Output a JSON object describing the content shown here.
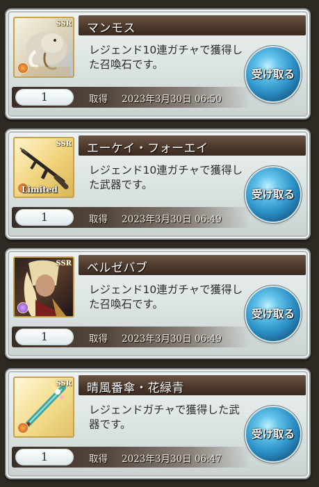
{
  "items": [
    {
      "name": "マンモス",
      "description": "レジェンド10連ガチャで獲得した召喚石です。",
      "rarity": "SSR",
      "element_color": "#c3521b",
      "element": "fire",
      "limited": "",
      "quantity": "1",
      "acquired_label": "取得",
      "date": "2023年3月30日 06:50",
      "button_label": "受け取る",
      "art": "mammoth"
    },
    {
      "name": "エーケイ・フォーエイ",
      "description": "レジェンド10連ガチャで獲得した武器です。",
      "rarity": "SSR",
      "element_color": "#c3521b",
      "element": "fire",
      "limited": "Limited",
      "quantity": "1",
      "acquired_label": "取得",
      "date": "2023年3月30日 06:49",
      "button_label": "受け取る",
      "art": "rifle"
    },
    {
      "name": "ベルゼバブ",
      "description": "レジェンド10連ガチャで獲得した召喚石です。",
      "rarity": "SSR",
      "element_color": "#7b3cc4",
      "element": "dark",
      "limited": "",
      "quantity": "1",
      "acquired_label": "取得",
      "date": "2023年3月30日 06:49",
      "button_label": "受け取る",
      "art": "beelzebub"
    },
    {
      "name": "晴風番傘・花緑青",
      "description": "レジェンドガチャで獲得した武器です。",
      "rarity": "SSR",
      "element_color": "#c3521b",
      "element": "fire",
      "limited": "",
      "quantity": "1",
      "acquired_label": "取得",
      "date": "2023年3月30日 06:47",
      "button_label": "受け取る",
      "art": "umbrella"
    }
  ]
}
